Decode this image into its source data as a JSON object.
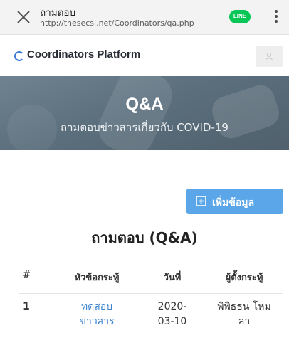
{
  "browser": {
    "tab_title": "ถามตอบ",
    "url": "http://thesecsi.net/Coordinators/qa.php",
    "line_badge": "LINE",
    "close_icon": "close-icon",
    "menu_icon": "kebab-menu-icon"
  },
  "navbar": {
    "brand": "Coordinators Platform",
    "brand_icon": "ring-logo-icon",
    "user_icon": "user-icon"
  },
  "hero": {
    "title": "Q&A",
    "subtitle": "ถามตอบข่าวสารเกี่ยวกับ COVID-19"
  },
  "actions": {
    "add_label": "เพิ่มข้อมูล",
    "add_icon": "plus-square-icon"
  },
  "section": {
    "title": "ถามตอบ (Q&A)"
  },
  "table": {
    "headers": [
      "#",
      "หัวข้อกระทู้",
      "วันที่",
      "ผู้ตั้งกระทู้"
    ],
    "rows": [
      {
        "num": "1",
        "topic_line1": "ทดสอบ",
        "topic_line2": "ข่าวสาร",
        "date_line1": "2020-",
        "date_line2": "03-10",
        "author_line1": "พิพิธธน โหม",
        "author_line2": "ลา"
      }
    ]
  },
  "colors": {
    "accent": "#5aa6e8",
    "link": "#3f86cf",
    "line_green": "#06c755",
    "hero_bg": "#5b6f7d"
  }
}
